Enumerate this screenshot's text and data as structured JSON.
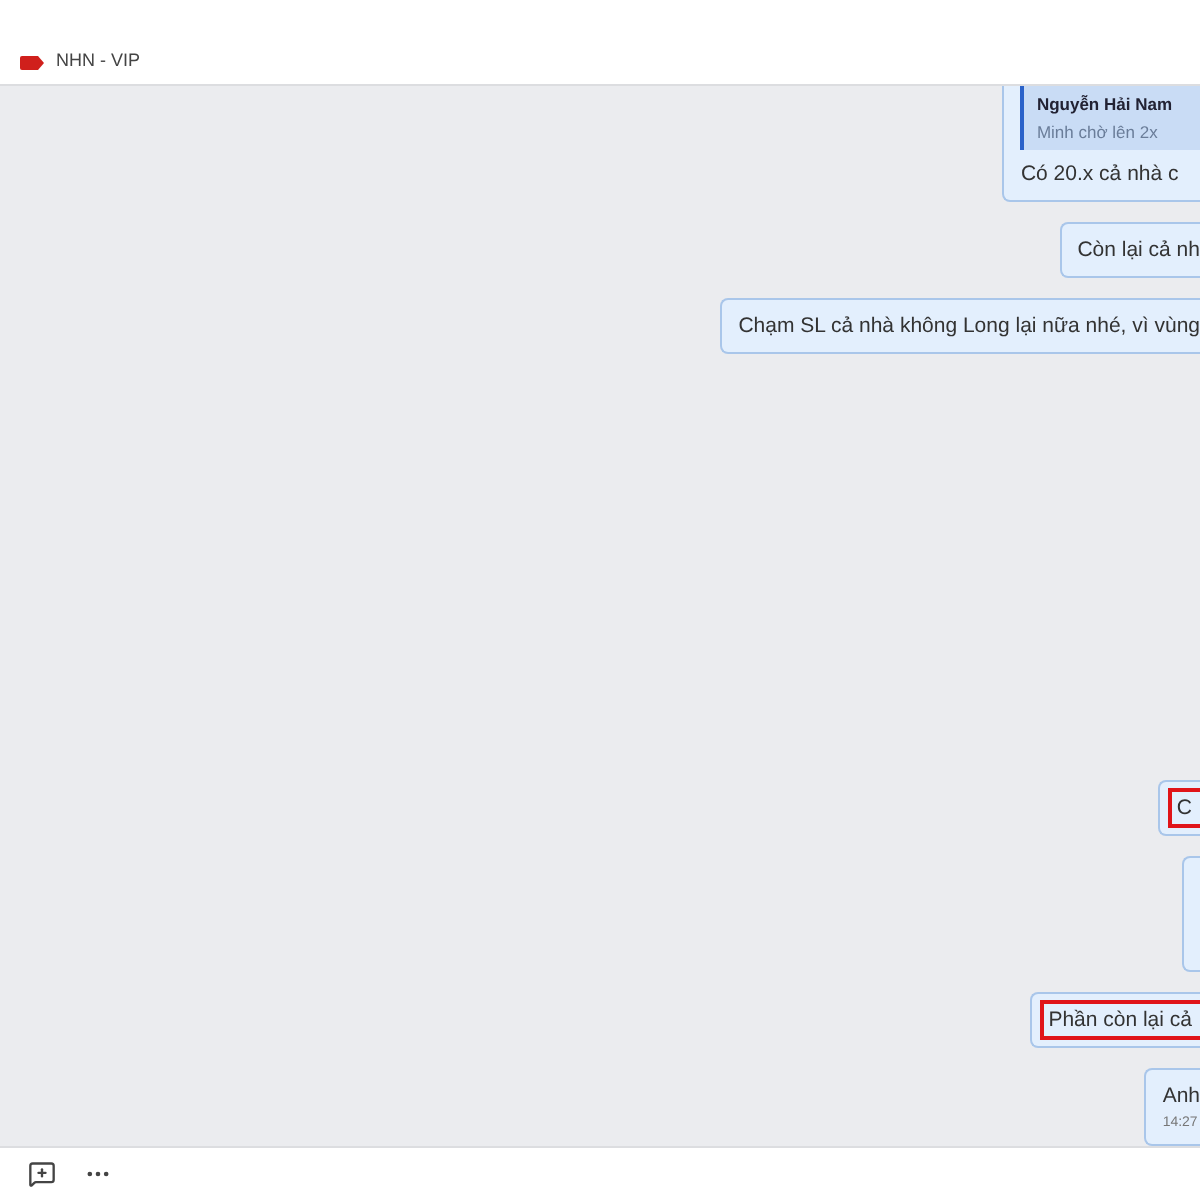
{
  "header": {
    "tag": {
      "label": "NHN - VIP",
      "color": "#d0201c"
    }
  },
  "messages": [
    {
      "kind": "quote",
      "quote_author": "Nguyễn Hải Nam",
      "quote_text": "Minh chờ lên 2x",
      "text": "Có 20.x cả nhà c",
      "highlighted": false
    },
    {
      "kind": "text",
      "text": "Còn lại cả nh",
      "highlighted": false
    },
    {
      "kind": "text",
      "text": "Chạm SL cả nhà không Long lại nữa nhé, vì vùng",
      "highlighted": false
    },
    {
      "kind": "spacer"
    },
    {
      "kind": "text",
      "text": "C",
      "highlighted": true
    },
    {
      "kind": "blank"
    },
    {
      "kind": "text",
      "text": "Phần còn lại cả",
      "highlighted": true
    },
    {
      "kind": "timed",
      "text": "Anh",
      "time": "14:27",
      "highlighted": false
    }
  ]
}
